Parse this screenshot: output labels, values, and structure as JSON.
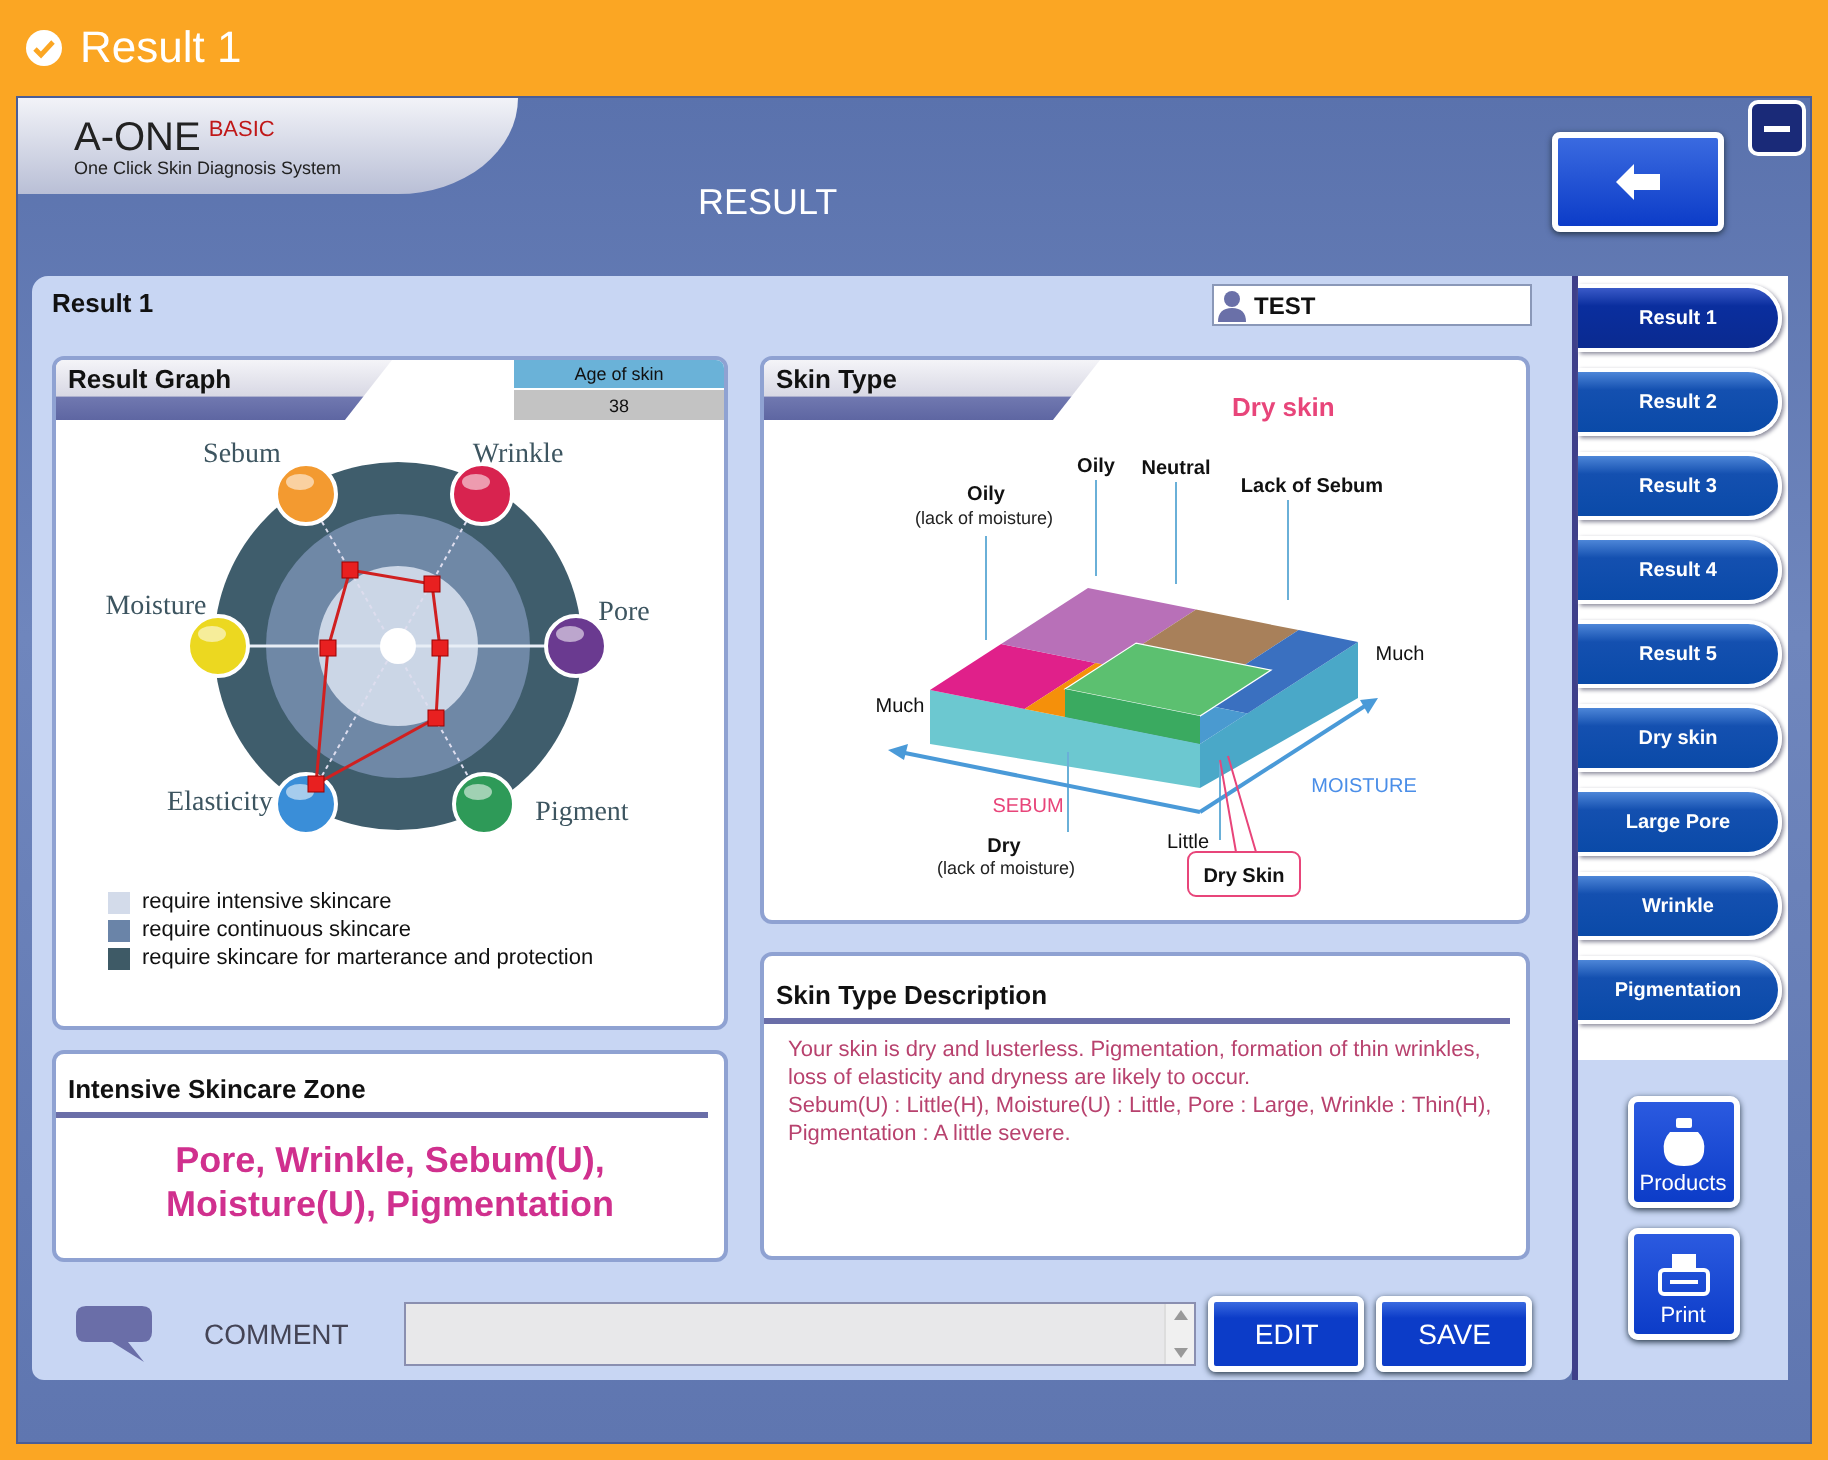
{
  "window": {
    "title": "Result 1"
  },
  "header": {
    "brand": "A-ONE",
    "edition": "BASIC",
    "tagline": "One Click Skin Diagnosis System",
    "page_title": "RESULT"
  },
  "result": {
    "title": "Result 1",
    "user": "TEST"
  },
  "result_graph": {
    "title": "Result Graph",
    "age_label": "Age of skin",
    "age_value": "38",
    "axes": [
      {
        "label": "Sebum",
        "color": "#f39a30"
      },
      {
        "label": "Wrinkle",
        "color": "#d8234f"
      },
      {
        "label": "Pore",
        "color": "#6a3a90"
      },
      {
        "label": "Pigment",
        "color": "#2e9a58"
      },
      {
        "label": "Elasticity",
        "color": "#3a8ed8"
      },
      {
        "label": "Moisture",
        "color": "#ecd820"
      }
    ],
    "legend": [
      {
        "label": "require intensive skincare",
        "color": "#d3dbea"
      },
      {
        "label": "require continuous skincare",
        "color": "#6a84a8"
      },
      {
        "label": "require skincare for marterance and protection",
        "color": "#3e5a66"
      }
    ]
  },
  "skin_type": {
    "title": "Skin Type",
    "result": "Dry skin",
    "labels": [
      {
        "kind": "category",
        "text": "Oily"
      },
      {
        "kind": "note",
        "text": "(lack of moisture)"
      },
      {
        "kind": "category",
        "text": "Oily"
      },
      {
        "kind": "category",
        "text": "Neutral"
      },
      {
        "kind": "category",
        "text": "Lack of Sebum"
      },
      {
        "kind": "scale",
        "text": "Much"
      },
      {
        "kind": "scale",
        "text": "Much"
      },
      {
        "kind": "axis",
        "text": "SEBUM",
        "color": "#e8457a"
      },
      {
        "kind": "axis",
        "text": "MOISTURE",
        "color": "#4a8ee8"
      },
      {
        "kind": "scale",
        "text": "Little"
      },
      {
        "kind": "category",
        "text": "Dry"
      },
      {
        "kind": "note",
        "text": "(lack of moisture)"
      }
    ],
    "marker": "Dry Skin"
  },
  "intensive_zone": {
    "title": "Intensive Skincare Zone",
    "text": "Pore, Wrinkle, Sebum(U), Moisture(U), Pigmentation"
  },
  "description": {
    "title": "Skin Type Description",
    "text": "Your skin is dry and lusterless. Pigmentation, formation of thin wrinkles, loss of elasticity and dryness are likely to occur.\nSebum(U) : Little(H), Moisture(U) : Little, Pore : Large, Wrinkle : Thin(H), Pigmentation : A little severe."
  },
  "comment": {
    "label": "COMMENT"
  },
  "buttons": [
    "EDIT",
    "SAVE"
  ],
  "sidebar": {
    "items": [
      {
        "label": "Result 1",
        "selected": true
      },
      {
        "label": "Result 2",
        "selected": false
      },
      {
        "label": "Result 3",
        "selected": false
      },
      {
        "label": "Result 4",
        "selected": false
      },
      {
        "label": "Result 5",
        "selected": false
      },
      {
        "label": "Dry skin",
        "selected": false
      },
      {
        "label": "Large Pore",
        "selected": false
      },
      {
        "label": "Wrinkle",
        "selected": false
      },
      {
        "label": "Pigmentation",
        "selected": false
      }
    ],
    "actions": [
      {
        "kind": "products",
        "label": "Products"
      },
      {
        "kind": "print",
        "label": "Print"
      }
    ]
  }
}
